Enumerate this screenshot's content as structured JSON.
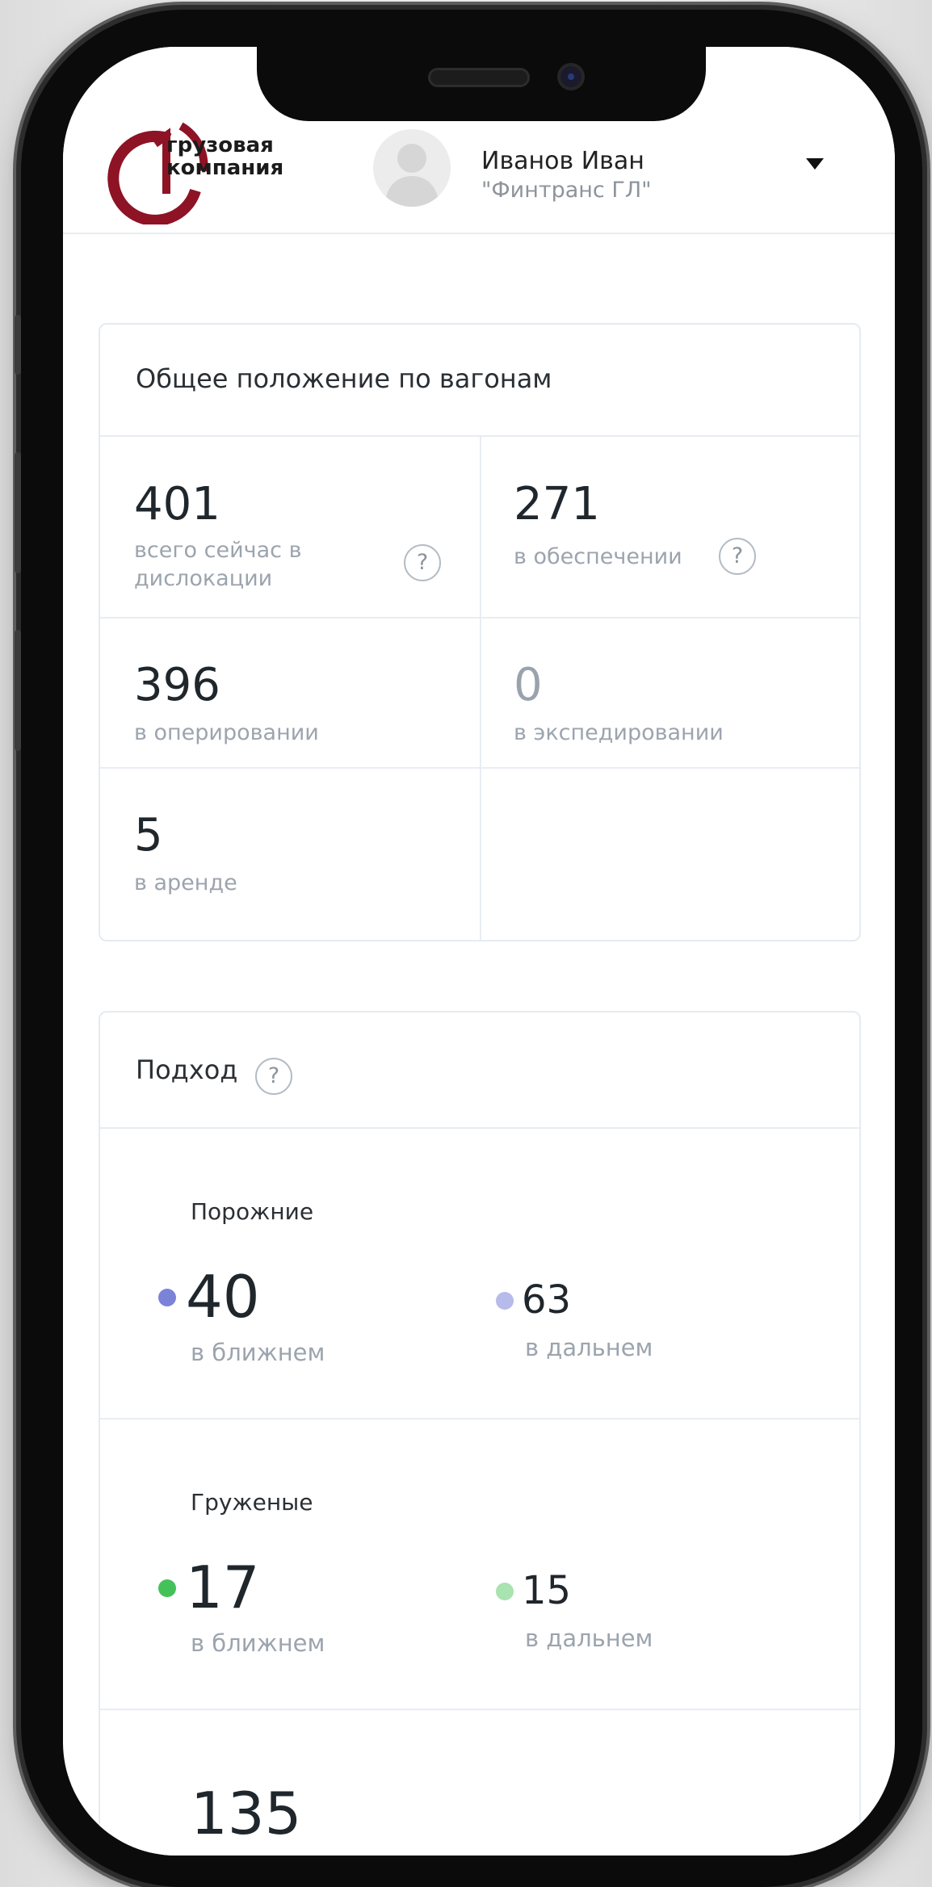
{
  "header": {
    "logo_line1": "грузовая",
    "logo_line2": "компания",
    "user_name": "Иванов Иван",
    "user_org": "\"Финтранс ГЛ\""
  },
  "wagons": {
    "title": "Общее положение по вагонам",
    "total_value": "401",
    "total_label": "всего сейчас в дислокации",
    "provision_value": "271",
    "provision_label": "в обеспечении",
    "operating_value": "396",
    "operating_label": "в оперировании",
    "forwarding_value": "0",
    "forwarding_label": "в экспедировании",
    "rent_value": "5",
    "rent_label": "в аренде",
    "help_glyph": "?"
  },
  "approach": {
    "title": "Подход",
    "help_glyph": "?",
    "empty": {
      "title": "Порожние",
      "near_value": "40",
      "near_label": "в ближнем",
      "far_value": "63",
      "far_label": "в дальнем",
      "near_color": "#7b83d8",
      "far_color": "#b7bbea"
    },
    "loaded": {
      "title": "Груженые",
      "near_value": "17",
      "near_label": "в ближнем",
      "far_value": "15",
      "far_label": "в дальнем",
      "near_color": "#45c15a",
      "far_color": "#a8e3b0"
    },
    "third_value": "135"
  }
}
